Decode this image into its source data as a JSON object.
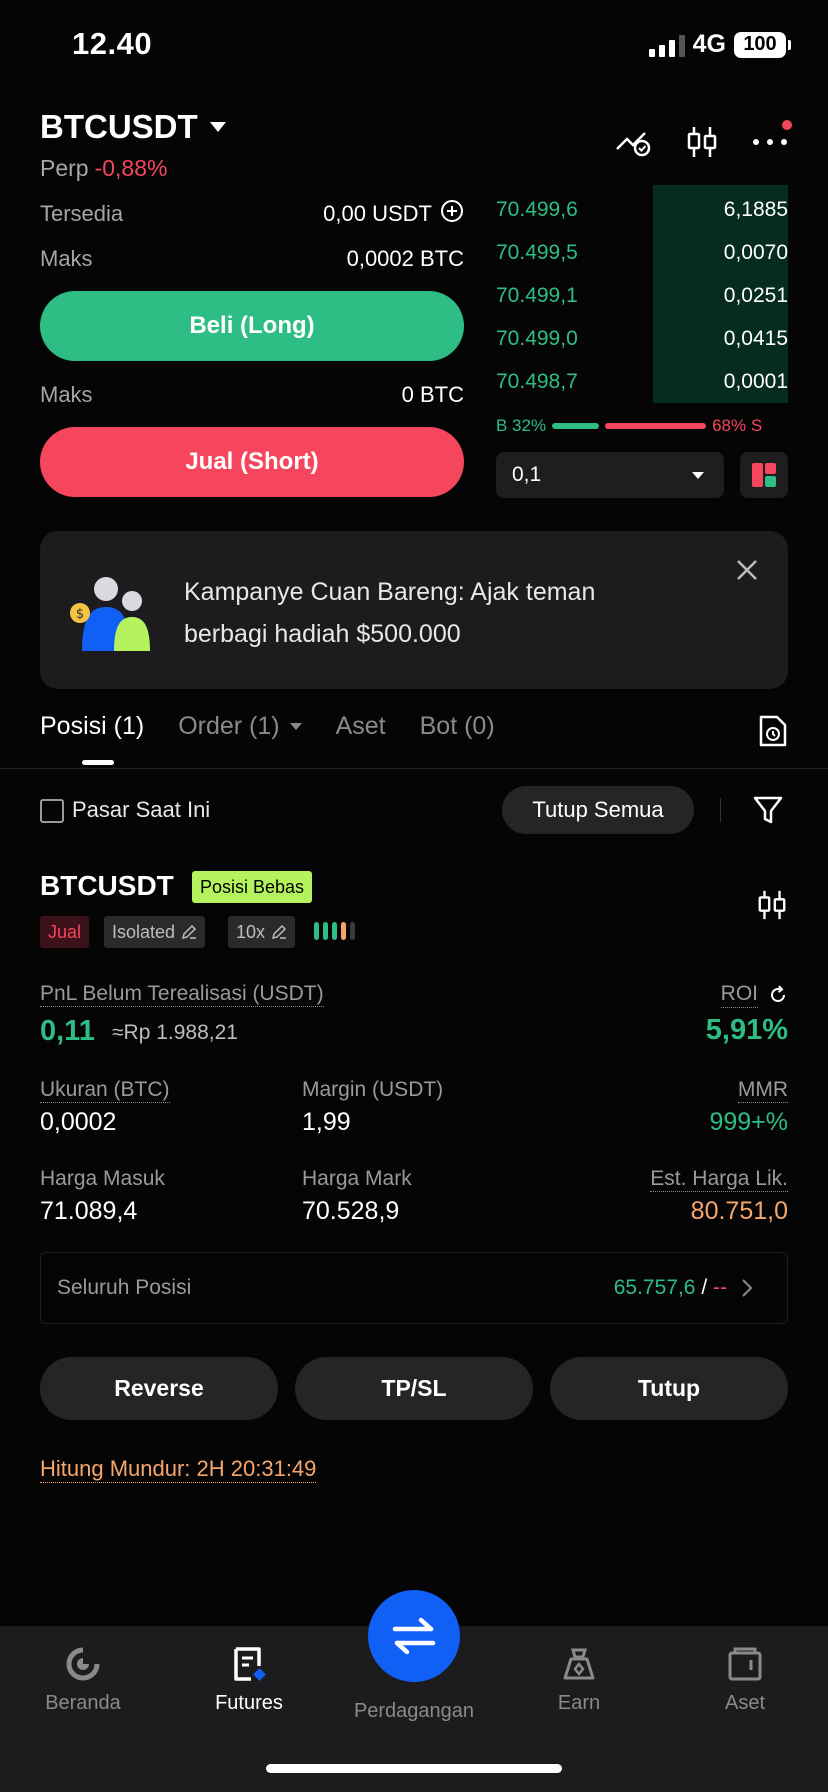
{
  "status": {
    "time": "12.40",
    "network": "4G",
    "battery": "100"
  },
  "header": {
    "symbol": "BTCUSDT",
    "type": "Perp",
    "change": "-0,88%"
  },
  "order_form": {
    "available_label": "Tersedia",
    "available_value": "0,00 USDT",
    "max_label": "Maks",
    "max_long_value": "0,0002 BTC",
    "long_button": "Beli (Long)",
    "max_short_value": "0 BTC",
    "short_button": "Jual (Short)"
  },
  "orderbook": {
    "rows": [
      {
        "price": "70.499,6",
        "qty": "6,1885"
      },
      {
        "price": "70.499,5",
        "qty": "0,0070"
      },
      {
        "price": "70.499,1",
        "qty": "0,0251"
      },
      {
        "price": "70.499,0",
        "qty": "0,0415"
      },
      {
        "price": "70.498,7",
        "qty": "0,0001"
      }
    ],
    "buy_ratio": "B 32%",
    "sell_ratio": "68% S",
    "buy_fraction": 0.32,
    "depth": "0,1"
  },
  "banner": {
    "text": "Kampanye Cuan Bareng: Ajak teman berbagi hadiah $500.000"
  },
  "tabs": {
    "positions": "Posisi (1)",
    "orders": "Order (1)",
    "assets": "Aset",
    "bots": "Bot (0)"
  },
  "filters": {
    "current_market": "Pasar Saat Ini",
    "close_all": "Tutup Semua"
  },
  "position": {
    "symbol": "BTCUSDT",
    "mode_tag": "Posisi Bebas",
    "side": "Jual",
    "margin_mode": "Isolated",
    "leverage": "10x",
    "pnl_label": "PnL Belum Terealisasi (USDT)",
    "pnl_value": "0,11",
    "pnl_idr": "≈Rp 1.988,21",
    "roi_label": "ROI",
    "roi_value": "5,91%",
    "size_label": "Ukuran (BTC)",
    "size_value": "0,0002",
    "margin_label": "Margin (USDT)",
    "margin_value": "1,99",
    "mmr_label": "MMR",
    "mmr_value": "999+%",
    "entry_label": "Harga Masuk",
    "entry_value": "71.089,4",
    "mark_label": "Harga Mark",
    "mark_value": "70.528,9",
    "liq_label": "Est. Harga Lik.",
    "liq_value": "80.751,0",
    "all_positions_label": "Seluruh Posisi",
    "all_positions_value": "65.757,6",
    "all_positions_sep": " / ",
    "all_positions_dash": "--"
  },
  "actions": {
    "reverse": "Reverse",
    "tpsl": "TP/SL",
    "close": "Tutup"
  },
  "countdown": "Hitung Mundur: 2H 20:31:49",
  "nav": {
    "home": "Beranda",
    "futures": "Futures",
    "trade": "Perdagangan",
    "earn": "Earn",
    "assets": "Aset"
  },
  "colors": {
    "green": "#2ebd85",
    "red": "#f6465d",
    "accent": "#1160f5",
    "orange": "#f7a66b"
  }
}
